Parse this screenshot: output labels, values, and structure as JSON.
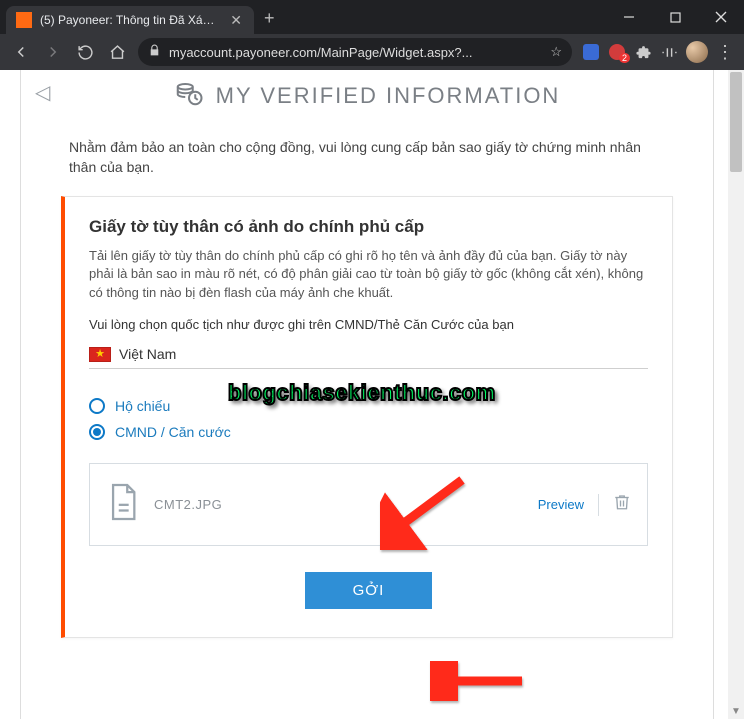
{
  "browser": {
    "tab_title": "(5) Payoneer: Thông tin Đã Xác m",
    "url": "myaccount.payoneer.com/MainPage/Widget.aspx?..."
  },
  "page": {
    "title": "MY VERIFIED INFORMATION",
    "intro": "Nhằm đảm bảo an toàn cho cộng đồng, vui lòng cung cấp bản sao giấy tờ chứng minh nhân thân của bạn."
  },
  "card": {
    "heading": "Giấy tờ tùy thân có ảnh do chính phủ cấp",
    "description": "Tải lên giấy tờ tùy thân do chính phủ cấp có ghi rõ họ tên và ảnh đầy đủ của bạn. Giấy tờ này phải là bản sao in màu rõ nét, có độ phân giải cao từ toàn bộ giấy tờ gốc (không cắt xén), không có thông tin nào bị đèn flash của máy ảnh che khuất.",
    "pick_label": "Vui lòng chọn quốc tịch như được ghi trên CMND/Thẻ Căn Cước của bạn",
    "country": "Việt Nam",
    "radios": {
      "passport": "Hộ chiếu",
      "idcard": "CMND / Căn cước"
    },
    "file": {
      "name": "CMT2.JPG",
      "preview": "Preview"
    },
    "submit": "GỞI"
  },
  "watermark": "blogchiasekienthuc.com"
}
